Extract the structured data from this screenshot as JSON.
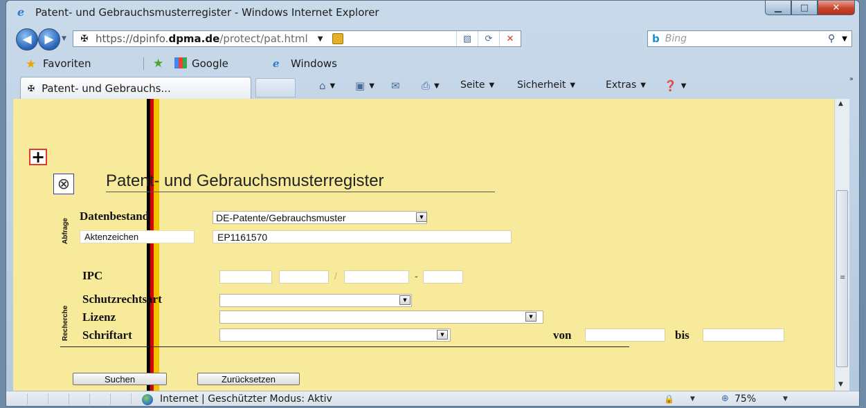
{
  "window": {
    "title": "Patent- und Gebrauchsmusterregister - Windows Internet Explorer",
    "title_icon": "ie-icon",
    "buttons": [
      "minimize-icon",
      "maximize-icon",
      "close-icon"
    ],
    "close_glyph": "✕"
  },
  "address": {
    "url_prefix": "https://dpinfo.",
    "url_domain": "dpma.de",
    "url_path": "/protect/pat.html",
    "search_placeholder": "Bing",
    "search_logo": "b"
  },
  "favorites_bar": {
    "favorites_label": "Favoriten",
    "items": [
      {
        "label": "Google"
      },
      {
        "label": "Windows"
      }
    ]
  },
  "tabs": [
    {
      "label": "Patent- und Gebrauchs..."
    }
  ],
  "command_bar": {
    "seite": "Seite",
    "sicherheit": "Sicherheit",
    "extras": "Extras"
  },
  "page": {
    "title": "Patent- und Gebrauchsmusterregister",
    "section_abfrage": "Abfrage",
    "section_recherche": "Recherche",
    "datenbestand_label": "Datenbestand",
    "datenbestand_value": "DE-Patente/Gebrauchsmuster",
    "aktenzeichen_label": "Aktenzeichen",
    "aktenzeichen_value": "EP1161570",
    "ipc_label": "IPC",
    "ipc_slash": "/",
    "ipc_dash": "-",
    "schutzrechtsart_label": "Schutzrechtsart",
    "lizenz_label": "Lizenz",
    "schriftart_label": "Schriftart",
    "von_label": "von",
    "bis_label": "bis",
    "suchen_button": "Suchen",
    "zuruecksetzen_button": "Zurücksetzen"
  },
  "status_bar": {
    "zone_text": "Internet | Geschützter Modus: Aktiv",
    "zoom": "75%"
  },
  "colors": {
    "page_background": "#f8ea9b",
    "flag_black": "#000000",
    "flag_red": "#dd0000",
    "flag_gold": "#f2c400"
  }
}
